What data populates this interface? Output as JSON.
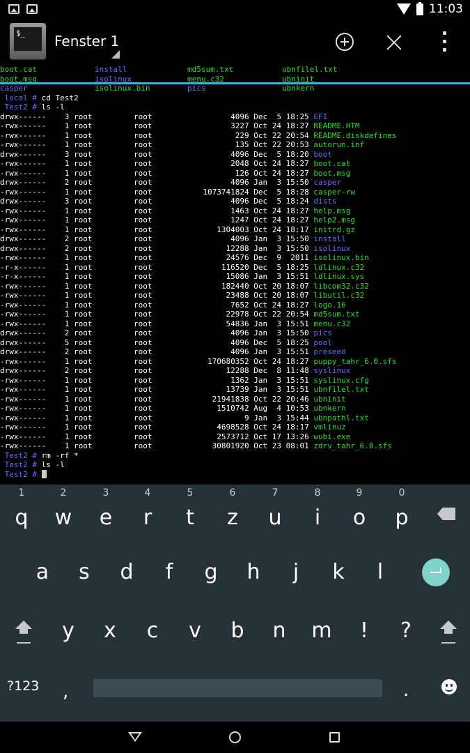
{
  "status_bar": {
    "time": "11:03"
  },
  "app_bar": {
    "title": "Fenster 1",
    "icon_text": "$_"
  },
  "terminal": {
    "ls_grid": [
      [
        "boot.cat",
        "install",
        "md5sum.txt",
        "ubnfilel.txt"
      ],
      [
        "boot.msg",
        "isolinux",
        "menu.c32",
        "ubninit"
      ],
      [
        "casper",
        "isolinux.bin",
        "pics",
        "ubnkern"
      ]
    ],
    "ls_grid_colors": [
      [
        "green",
        "blue",
        "green",
        "green"
      ],
      [
        "green",
        "blue",
        "green",
        "green"
      ],
      [
        "blue",
        "green",
        "blue",
        "green"
      ]
    ],
    "prompts": [
      {
        "prompt": " local # ",
        "command": "cd Test2"
      },
      {
        "prompt": " Test2 # ",
        "command": "ls -l"
      }
    ],
    "listing": [
      {
        "meta": "drwx------    3 root         root                 4096 Dec  5 18:25 ",
        "name": "EFI",
        "color": "blue"
      },
      {
        "meta": "-rwx------    1 root         root                 3227 Oct 24 18:27 ",
        "name": "README.HTM",
        "color": "green"
      },
      {
        "meta": "-rwx------    1 root         root                  229 Oct 22 20:54 ",
        "name": "README.diskdefines",
        "color": "green"
      },
      {
        "meta": "-rwx------    1 root         root                  135 Oct 22 20:53 ",
        "name": "autorun.inf",
        "color": "green"
      },
      {
        "meta": "drwx------    3 root         root                 4096 Dec  5 18:20 ",
        "name": "boot",
        "color": "blue"
      },
      {
        "meta": "-rwx------    1 root         root                 2048 Oct 24 18:27 ",
        "name": "boot.cat",
        "color": "green"
      },
      {
        "meta": "-rwx------    1 root         root                  126 Oct 24 18:27 ",
        "name": "boot.msg",
        "color": "green"
      },
      {
        "meta": "drwx------    2 root         root                 4096 Jan  3 15:50 ",
        "name": "casper",
        "color": "blue"
      },
      {
        "meta": "-rwx------    1 root         root           1073741824 Dec  5 18:28 ",
        "name": "casper-rw",
        "color": "green"
      },
      {
        "meta": "drwx------    3 root         root                 4096 Dec  5 18:24 ",
        "name": "dists",
        "color": "blue"
      },
      {
        "meta": "-rwx------    1 root         root                 1463 Oct 24 18:27 ",
        "name": "help.msg",
        "color": "green"
      },
      {
        "meta": "-rwx------    1 root         root                 1247 Oct 24 18:27 ",
        "name": "help2.msg",
        "color": "green"
      },
      {
        "meta": "-rwx------    1 root         root              1304003 Oct 24 18:17 ",
        "name": "initrd.gz",
        "color": "green"
      },
      {
        "meta": "drwx------    2 root         root                 4096 Jan  3 15:50 ",
        "name": "install",
        "color": "blue"
      },
      {
        "meta": "drwx------    2 root         root                12288 Jan  3 15:50 ",
        "name": "isolinux",
        "color": "blue"
      },
      {
        "meta": "-rwx------    1 root         root                24576 Dec  9  2011 ",
        "name": "isolinux.bin",
        "color": "green"
      },
      {
        "meta": "-r-x------    1 root         root               116520 Dec  5 18:25 ",
        "name": "ldlinux.c32",
        "color": "green"
      },
      {
        "meta": "-r-x------    1 root         root                15086 Jan  3 15:51 ",
        "name": "ldlinux.sys",
        "color": "green"
      },
      {
        "meta": "-rwx------    1 root         root               182440 Oct 20 18:07 ",
        "name": "libcom32.c32",
        "color": "green"
      },
      {
        "meta": "-rwx------    1 root         root                23488 Oct 20 18:07 ",
        "name": "libutil.c32",
        "color": "green"
      },
      {
        "meta": "-rwx------    1 root         root                 7652 Oct 24 18:27 ",
        "name": "logo.16",
        "color": "green"
      },
      {
        "meta": "-rwx------    1 root         root                22978 Oct 22 20:54 ",
        "name": "md5sum.txt",
        "color": "green"
      },
      {
        "meta": "-rwx------    1 root         root                54836 Jan  3 15:51 ",
        "name": "menu.c32",
        "color": "green"
      },
      {
        "meta": "drwx------    2 root         root                 4096 Jan  3 15:50 ",
        "name": "pics",
        "color": "blue"
      },
      {
        "meta": "drwx------    5 root         root                 4096 Dec  5 18:25 ",
        "name": "pool",
        "color": "blue"
      },
      {
        "meta": "drwx------    2 root         root                 4096 Jan  3 15:51 ",
        "name": "preseed",
        "color": "blue"
      },
      {
        "meta": "-rwx------    1 root         root            170680352 Oct 24 18:27 ",
        "name": "puppy_tahr_6.0.sfs",
        "color": "green"
      },
      {
        "meta": "drwx------    2 root         root                12288 Dec  8 11:48 ",
        "name": "syslinux",
        "color": "blue"
      },
      {
        "meta": "-rwx------    1 root         root                 1362 Jan  3 15:51 ",
        "name": "syslinux.cfg",
        "color": "green"
      },
      {
        "meta": "-rwx------    1 root         root                13739 Jan  3 15:51 ",
        "name": "ubnfilel.txt",
        "color": "green"
      },
      {
        "meta": "-rwx------    1 root         root             21941838 Oct 22 20:46 ",
        "name": "ubninit",
        "color": "green"
      },
      {
        "meta": "-rwx------    1 root         root              1510742 Aug  4 10:53 ",
        "name": "ubnkern",
        "color": "green"
      },
      {
        "meta": "-rwx------    1 root         root                    9 Jan  3 15:44 ",
        "name": "ubnpathl.txt",
        "color": "green"
      },
      {
        "meta": "-rwx------    1 root         root              4698528 Oct 24 18:17 ",
        "name": "vmlinuz",
        "color": "green"
      },
      {
        "meta": "-rwx------    1 root         root              2573712 Oct 17 13:26 ",
        "name": "wubi.exe",
        "color": "green"
      },
      {
        "meta": "-rwx------    1 root         root             30801920 Oct 23 08:01 ",
        "name": "zdrv_tahr_6.0.sfs",
        "color": "green"
      }
    ],
    "after": [
      {
        "prompt": " Test2 # ",
        "command": "rm -rf *"
      },
      {
        "prompt": " Test2 # ",
        "command": "ls -l"
      }
    ],
    "current_prompt": " Test2 # "
  },
  "keyboard": {
    "row1": [
      {
        "key": "q",
        "hint": "1"
      },
      {
        "key": "w",
        "hint": "2"
      },
      {
        "key": "e",
        "hint": "3"
      },
      {
        "key": "r",
        "hint": "4"
      },
      {
        "key": "t",
        "hint": "5"
      },
      {
        "key": "z",
        "hint": "6"
      },
      {
        "key": "u",
        "hint": "7"
      },
      {
        "key": "i",
        "hint": "8"
      },
      {
        "key": "o",
        "hint": "9"
      },
      {
        "key": "p",
        "hint": "0"
      }
    ],
    "row2": [
      "a",
      "s",
      "d",
      "f",
      "g",
      "h",
      "j",
      "k",
      "l"
    ],
    "row3": [
      "y",
      "x",
      "c",
      "v",
      "b",
      "n",
      "m",
      "!",
      "?"
    ],
    "symbols_label": "?123",
    "comma": ",",
    "period": "."
  },
  "colors": {
    "prompt_blue": "#6b6bff",
    "file_green": "#2cdc2c",
    "accent": "#33b5e5",
    "keyboard_bg": "#263238"
  }
}
